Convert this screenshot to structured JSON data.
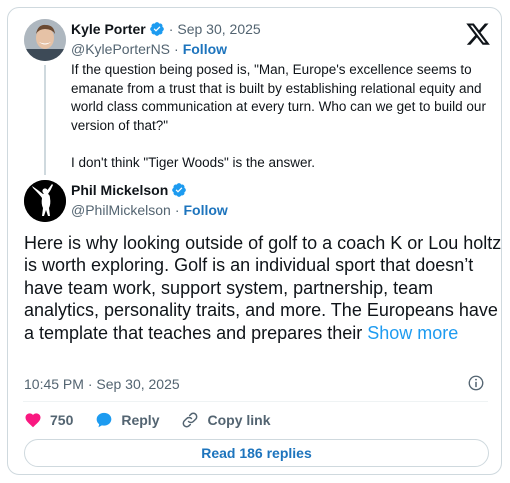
{
  "quoted_tweet": {
    "display_name": "Kyle Porter",
    "verified": true,
    "separator": "·",
    "date": "Sep 30, 2025",
    "handle": "@KylePorterNS",
    "follow_label": "Follow",
    "text_para_1": "If the question being posed is, \"Man, Europe's excellence seems to emanate from a trust that is built by establishing relational equity and world class communication at every turn. Who can we get to build our version of that?\"",
    "text_para_2": "I don't think \"Tiger Woods\" is the answer."
  },
  "main_tweet": {
    "display_name": "Phil Mickelson",
    "verified": true,
    "separator": "·",
    "handle": "@PhilMickelson",
    "follow_label": "Follow",
    "text": "Here is why looking outside of golf to a coach K or Lou holtz is worth exploring. Golf is an individual sport that doesn’t have team work, support system, partnership, team analytics, personality traits, and more. The Europeans have a template that teaches and prepares their",
    "show_more": "Show more",
    "timestamp": "10:45 PM · Sep 30, 2025"
  },
  "actions": {
    "likes_count": "750",
    "reply_label": "Reply",
    "copy_link_label": "Copy link"
  },
  "read_replies_label": "Read 186 replies",
  "icons": {
    "logo": "x-logo-icon",
    "verified": "verified-badge-icon",
    "info": "info-icon",
    "like": "heart-icon",
    "reply": "speech-bubble-icon",
    "copy_link": "link-icon"
  },
  "colors": {
    "verified_blue": "#1d9bf0",
    "like_pink": "#f91880",
    "follow_link": "#1d74bd",
    "secondary_text": "#536471",
    "border": "#cfd9de"
  }
}
